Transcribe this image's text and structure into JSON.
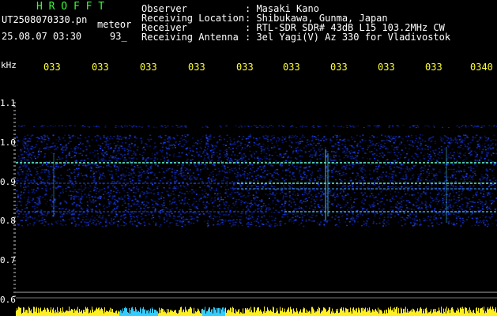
{
  "header": {
    "title": "H R O F F T",
    "file_name": "UT2508070330.pn",
    "mode_label": "meteor",
    "date_time": "25.08.07 03:30",
    "count": "93_",
    "observer_label": "Observer",
    "observer_value": ": Masaki Kano",
    "location_label": "Receiving Location",
    "location_value": ": Shibukawa, Gunma, Japan",
    "receiver_label": "Receiver",
    "receiver_value": ": RTL-SDR SDR# 43dB L15 103.2MHz CW",
    "antenna_label": "Receiving Antenna",
    "antenna_value": ": 3el Yagi(V) Az 330 for Vladivostok"
  },
  "axis": {
    "unit": "kHz",
    "freq_labels": [
      "1.1",
      "1.0",
      "0.9",
      "0.8",
      "0.7",
      "0.6"
    ],
    "time_labels": [
      "033",
      "033",
      "033",
      "033",
      "033",
      "033",
      "033",
      "033",
      "033",
      "0340"
    ]
  },
  "colors": {
    "title_green": "#33ff33",
    "time_yellow": "#ffff33",
    "signal_blue": "#1a3cff",
    "echo_cyan": "#66ffcc"
  }
}
